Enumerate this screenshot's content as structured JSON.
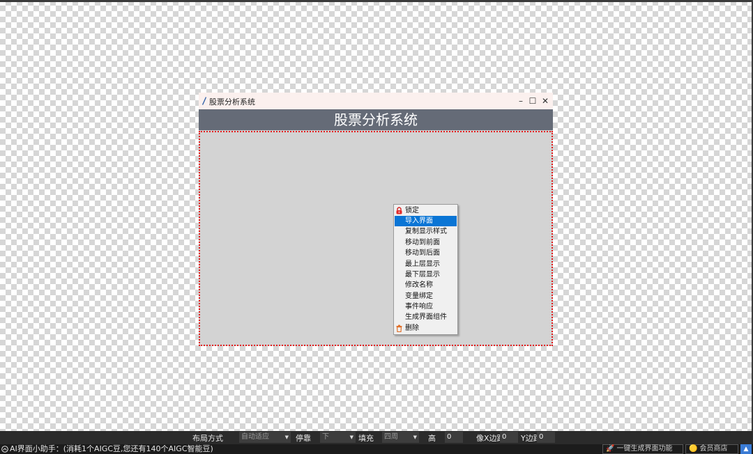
{
  "window": {
    "title": "股票分析系统",
    "header_text": "股票分析系统",
    "minimize_glyph": "–",
    "maximize_glyph": "☐",
    "close_glyph": "✕"
  },
  "context_menu": {
    "items": [
      {
        "label": "锁定",
        "icon": "lock-icon"
      },
      {
        "label": "导入界面",
        "selected": true
      },
      {
        "label": "复制显示样式"
      },
      {
        "label": "移动到前面"
      },
      {
        "label": "移动到后面"
      },
      {
        "label": "最上层显示"
      },
      {
        "label": "最下层显示"
      },
      {
        "label": "修改名称"
      },
      {
        "label": "变量绑定"
      },
      {
        "label": "事件响应"
      },
      {
        "label": "生成界面组件"
      },
      {
        "label": "删除",
        "icon": "trash-icon"
      }
    ]
  },
  "property_bar": {
    "layout_label": "布局方式",
    "layout_value": "自动适应",
    "dock_label": "停靠",
    "dock_value": "下",
    "fill_label": "填充",
    "fill_value": "四周",
    "height_label": "高",
    "height_value": "0",
    "xmargin_label": "像X边距",
    "xmargin_value": "0",
    "ymargin_label": "Y边距",
    "ymargin_value": "0"
  },
  "status_bar": {
    "text": "AI界面小助手：(消耗1个AIGC豆,您还有140个AIGC智能豆)",
    "generate_button": "一键生成界面功能",
    "shop_button": "会员商店",
    "up_glyph": "▲"
  },
  "colors": {
    "header_bg": "#656b77",
    "selection": "#0a75d5",
    "border_dotted": "#e21a1a"
  }
}
